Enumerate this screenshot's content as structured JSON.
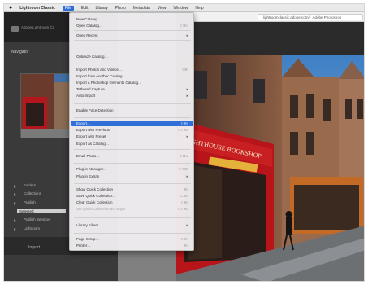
{
  "menubar": {
    "apple": "",
    "items": [
      "Lightroom Classic",
      "File",
      "Edit",
      "Library",
      "Photo",
      "Metadata",
      "View",
      "Window",
      "Help"
    ],
    "active_index": 1
  },
  "browser": {
    "url": "lightroomclassic.adobe.com/ · Adobe Photoshop"
  },
  "lightroom": {
    "logo_text": "Adobe Lightroom Classic",
    "navigator_label": "Navigator",
    "side_rows": [
      "Folders",
      "Collections",
      "Publish",
      "Selected",
      "Publish Services",
      "Lightroom"
    ],
    "selected_row": "Selected",
    "bottom_button": "Import…"
  },
  "file_menu": {
    "items": [
      {
        "label": "New Catalog…",
        "shortcut": ""
      },
      {
        "label": "Open Catalog…",
        "shortcut": "⇧⌘O"
      },
      {
        "label": "Open Recent",
        "shortcut": "",
        "submenu": true
      },
      {
        "label": "Optimize Catalog…",
        "shortcut": ""
      },
      {
        "label": "Import Photos and Videos…",
        "shortcut": "⇧⌘I"
      },
      {
        "label": "Import from Another Catalog…",
        "shortcut": ""
      },
      {
        "label": "Import a Photoshop Elements Catalog…",
        "shortcut": ""
      },
      {
        "label": "Tethered Capture",
        "shortcut": "",
        "submenu": true
      },
      {
        "label": "Auto Import",
        "shortcut": "",
        "submenu": true
      },
      {
        "label": "Enable Face Detection",
        "shortcut": ""
      },
      {
        "label": "Export…",
        "shortcut": "⇧⌘E",
        "highlight": true
      },
      {
        "label": "Export with Previous",
        "shortcut": "⌥⇧⌘E"
      },
      {
        "label": "Export with Preset",
        "shortcut": "",
        "submenu": true
      },
      {
        "label": "Export as Catalog…",
        "shortcut": ""
      },
      {
        "label": "Email Photo…",
        "shortcut": "⇧⌘M"
      },
      {
        "label": "Plug-in Manager…",
        "shortcut": "⌥⇧⌘,"
      },
      {
        "label": "Plug-in Extras",
        "shortcut": "",
        "submenu": true
      },
      {
        "label": "Show Quick Collection",
        "shortcut": "⌘B"
      },
      {
        "label": "Save Quick Collection…",
        "shortcut": "⌥⌘B"
      },
      {
        "label": "Clear Quick Collection",
        "shortcut": "⇧⌘B"
      },
      {
        "label": "Set Quick Collection as Target",
        "shortcut": "⌥⇧⌘B",
        "disabled": true
      },
      {
        "label": "Library Filters",
        "shortcut": "",
        "submenu": true
      },
      {
        "label": "Page Setup…",
        "shortcut": "⇧⌘P"
      },
      {
        "label": "Printer…",
        "shortcut": "⌘P"
      }
    ]
  },
  "photo": {
    "shop_sign": "LIGHTHOUSE BOOKSHOP"
  }
}
